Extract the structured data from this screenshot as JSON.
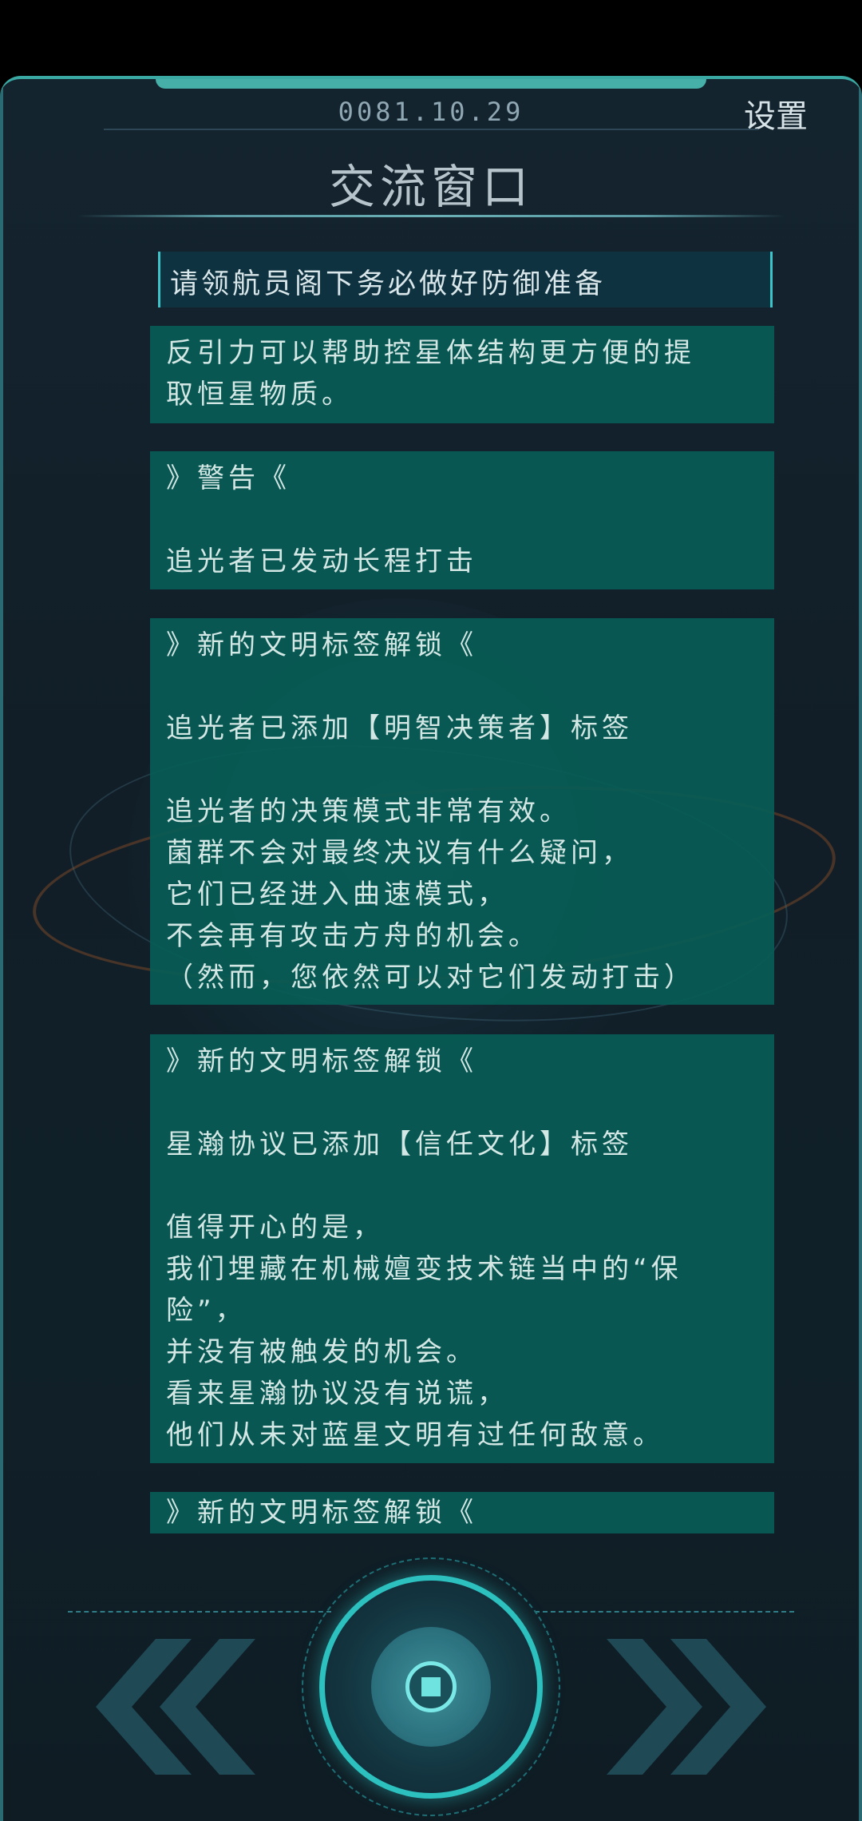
{
  "header": {
    "date": "0081.10.29",
    "settings_label": "设置",
    "title": "交流窗口"
  },
  "messages": {
    "highlight": "请领航员阁下务必做好防御准备",
    "m1": {
      "lines": [
        "反引力可以帮助控星体结构更方便的提",
        "取恒星物质。"
      ]
    },
    "m2": {
      "heading": "》警告《",
      "body": "追光者已发动长程打击"
    },
    "m3": {
      "heading": "》新的文明标签解锁《",
      "tag_line": "追光者已添加【明智决策者】标签",
      "lines": [
        "追光者的决策模式非常有效。",
        "菌群不会对最终决议有什么疑问，",
        "它们已经进入曲速模式，",
        "不会再有攻击方舟的机会。",
        "（然而，您依然可以对它们发动打击）"
      ]
    },
    "m4": {
      "heading": "》新的文明标签解锁《",
      "tag_line": "星瀚协议已添加【信任文化】标签",
      "lines": [
        "值得开心的是，",
        "我们埋藏在机械嬗变技术链当中的“保",
        "险”，",
        "并没有被触发的机会。",
        "看来星瀚协议没有说谎，",
        "他们从未对蓝星文明有过任何敌意。"
      ]
    },
    "m5": {
      "heading": "》新的文明标签解锁《"
    }
  },
  "controls": {
    "prev_icon": "double-chevron-left-icon",
    "next_icon": "double-chevron-right-icon",
    "center_icon": "core-button-icon"
  },
  "colors": {
    "message_bg": "#085c56",
    "accent": "#2cc0bf",
    "frame_top": "#3aa9a3"
  }
}
